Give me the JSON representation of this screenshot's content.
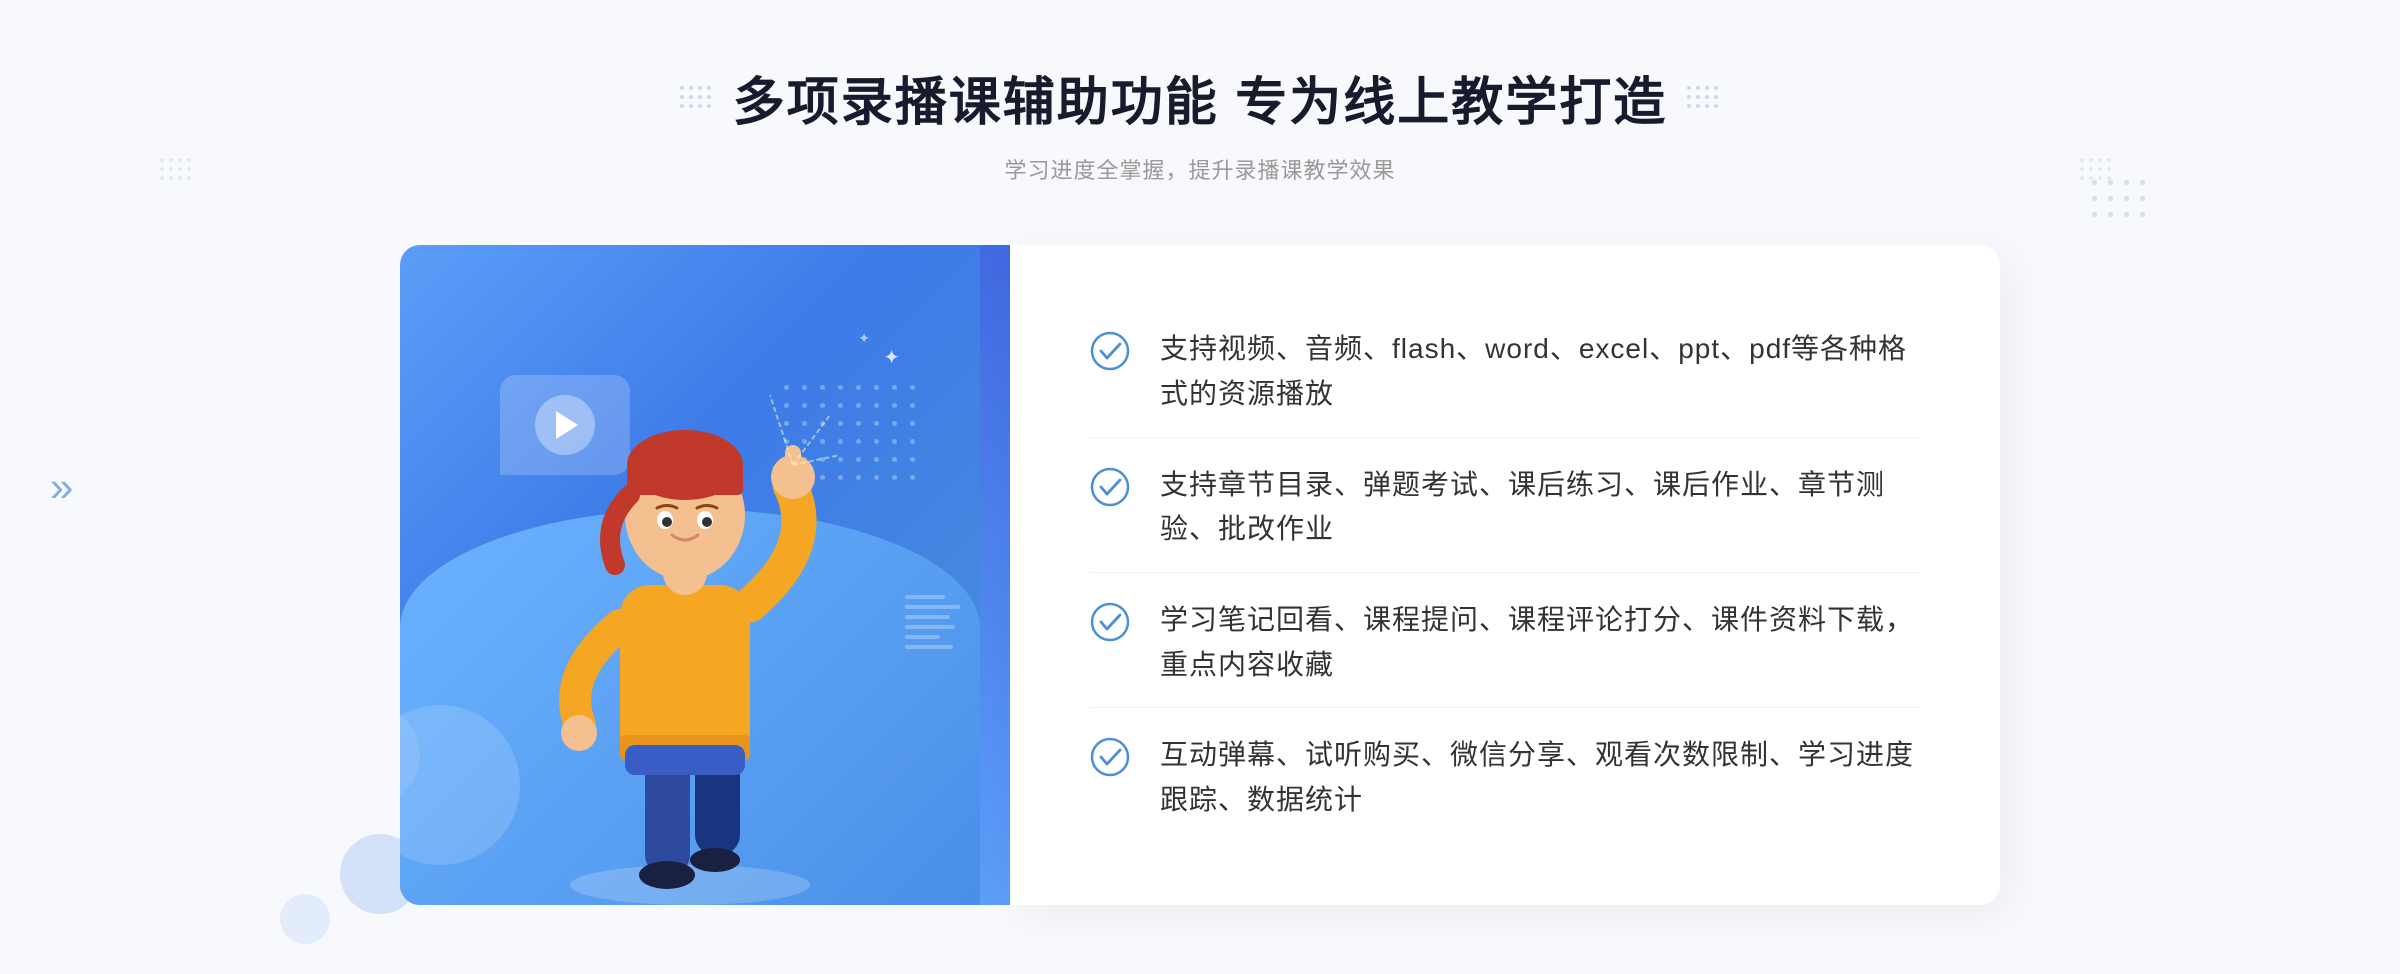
{
  "header": {
    "title": "多项录播课辅助功能 专为线上教学打造",
    "subtitle": "学习进度全掌握，提升录播课教学效果"
  },
  "features": [
    {
      "id": "feature-1",
      "text": "支持视频、音频、flash、word、excel、ppt、pdf等各种格式的资源播放"
    },
    {
      "id": "feature-2",
      "text": "支持章节目录、弹题考试、课后练习、课后作业、章节测验、批改作业"
    },
    {
      "id": "feature-3",
      "text": "学习笔记回看、课程提问、课程评论打分、课件资料下载，重点内容收藏"
    },
    {
      "id": "feature-4",
      "text": "互动弹幕、试听购买、微信分享、观看次数限制、学习进度跟踪、数据统计"
    }
  ],
  "decorations": {
    "left_arrow": "»",
    "check_icon_color": "#4a90d9"
  }
}
